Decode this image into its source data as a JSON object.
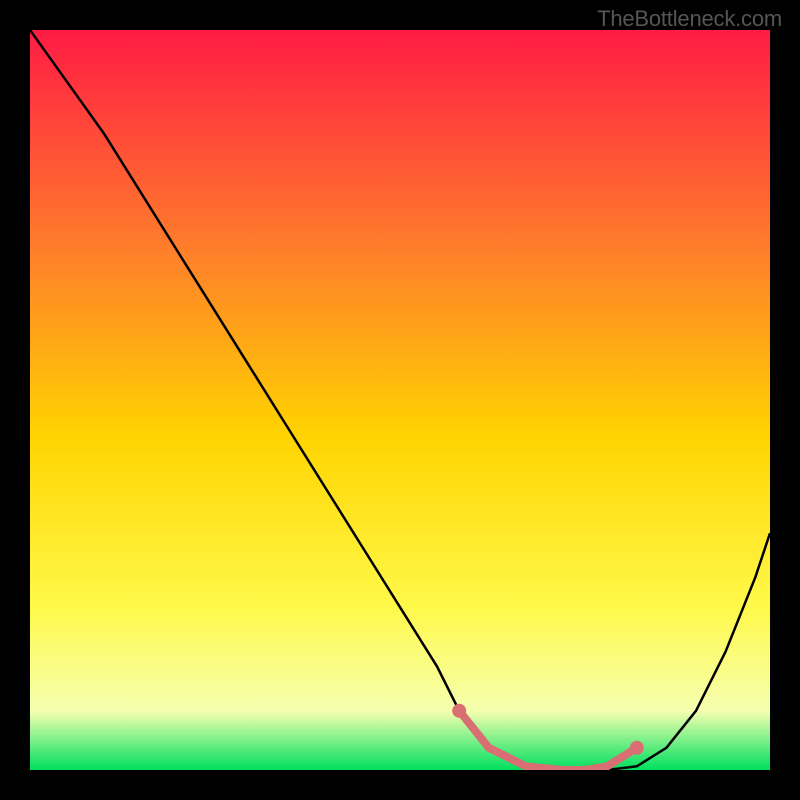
{
  "watermark": "TheBottleneck.com",
  "chart_data": {
    "type": "line",
    "title": "",
    "xlabel": "",
    "ylabel": "",
    "xlim": [
      0,
      100
    ],
    "ylim": [
      0,
      100
    ],
    "background_gradient": {
      "top": "#ff1b44",
      "mid_upper": "#ff7f2a",
      "mid": "#ffd400",
      "mid_lower": "#fff94a",
      "lower": "#f6ffb0",
      "bottom": "#00e060"
    },
    "series": [
      {
        "name": "bottleneck-curve",
        "stroke": "#000000",
        "x": [
          0,
          5,
          10,
          15,
          20,
          25,
          30,
          35,
          40,
          45,
          50,
          55,
          58,
          62,
          67,
          72,
          75,
          78,
          82,
          86,
          90,
          94,
          98,
          100
        ],
        "y": [
          100,
          93,
          86,
          78,
          70,
          62,
          54,
          46,
          38,
          30,
          22,
          14,
          8,
          3,
          0.5,
          0,
          0,
          0,
          0.5,
          3,
          8,
          16,
          26,
          32
        ]
      }
    ],
    "sweet_spot_marker": {
      "name": "optimal-range",
      "color": "#d96f73",
      "x": [
        58,
        62,
        67,
        72,
        75,
        78,
        82
      ],
      "y": [
        8,
        3,
        0.5,
        0,
        0,
        0.5,
        3
      ],
      "dot_x": [
        58,
        82
      ],
      "dot_y": [
        8,
        3
      ]
    }
  }
}
